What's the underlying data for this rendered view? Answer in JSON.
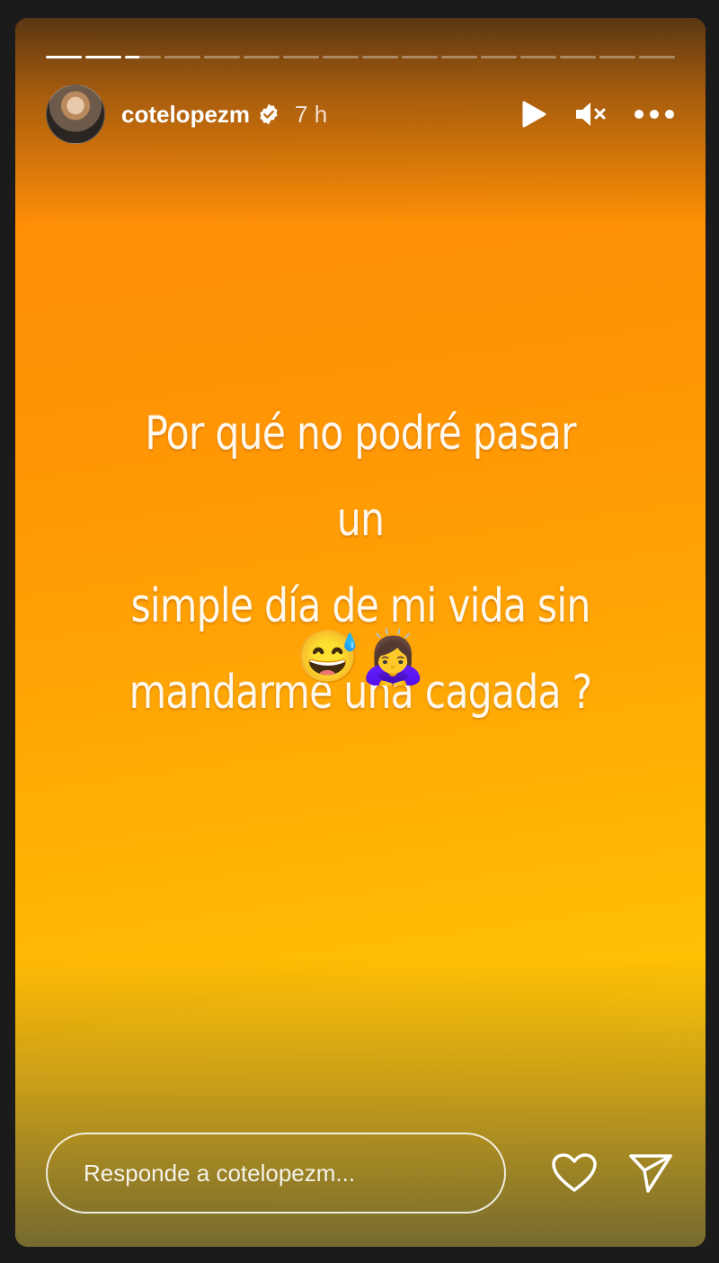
{
  "story": {
    "progress": {
      "segments": 16,
      "completed": 2,
      "current_fraction": 0.4
    },
    "user": {
      "username": "cotelopezm",
      "verified": true,
      "time_ago": "7 h"
    },
    "controls": {
      "play_icon": "play-icon",
      "mute_icon": "muted-speaker-icon",
      "more_icon": "more-horizontal-icon"
    },
    "caption": {
      "line1": "Por qué no podré pasar un",
      "line2": "simple día de mi vida sin",
      "line3": "mandarme una cagada ?",
      "emojis": "😅🙇‍♀️"
    },
    "reply": {
      "placeholder": "Responde a cotelopezm..."
    },
    "colors": {
      "gradient_top": "#ff8a08",
      "gradient_bottom": "#ffcd05",
      "text": "#ffffff"
    }
  }
}
